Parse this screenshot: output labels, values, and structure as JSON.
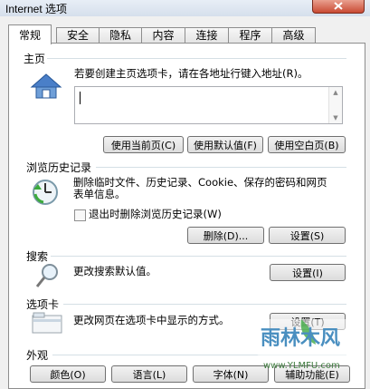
{
  "window": {
    "title": "Internet 选项"
  },
  "tabs": [
    "常规",
    "安全",
    "隐私",
    "内容",
    "连接",
    "程序",
    "高级"
  ],
  "home": {
    "title": "主页",
    "desc": "若要创建主页选项卡，请在各地址行键入地址(R)。",
    "buttons": [
      "使用当前页(C)",
      "使用默认值(F)",
      "使用空白页(B)"
    ]
  },
  "history": {
    "title": "浏览历史记录",
    "desc_line1": "删除临时文件、历史记录、Cookie、保存的密码和网页",
    "desc_line2": "表单信息。",
    "checkbox_label": "退出时删除浏览历史记录(W)",
    "delete_button": "删除(D)...",
    "settings_button": "设置(S)"
  },
  "search": {
    "title": "搜索",
    "desc": "更改搜索默认值。",
    "settings_button": "设置(I)"
  },
  "tabs_section": {
    "title": "选项卡",
    "desc": "更改网页在选项卡中显示的方式。",
    "settings_button": "设置(T)"
  },
  "appearance": {
    "title": "外观",
    "buttons": [
      "颜色(O)",
      "语言(L)",
      "字体(N)",
      "辅助功能(E)"
    ]
  },
  "watermark": {
    "text": "雨林木风",
    "url": "www.YLMFU.com"
  }
}
